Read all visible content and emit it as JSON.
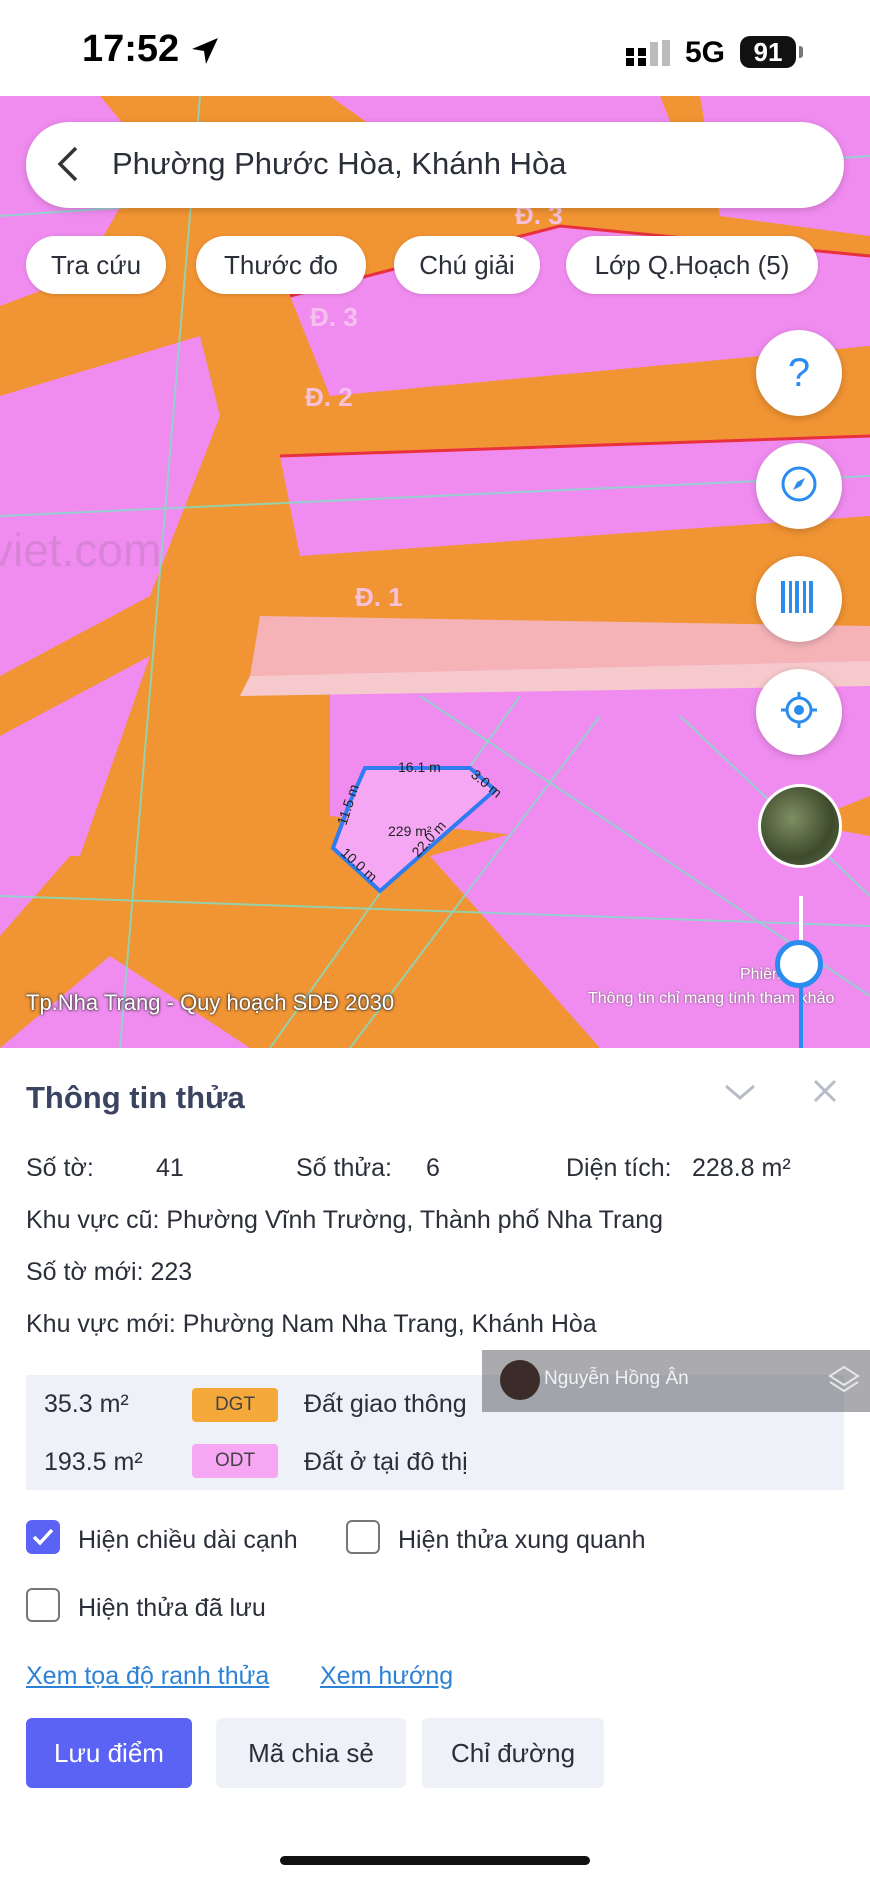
{
  "status_bar": {
    "time": "17:52",
    "network": "5G",
    "battery": "91"
  },
  "search": {
    "query": "Phường Phước Hòa, Khánh Hòa"
  },
  "chips": [
    "Tra cứu",
    "Thước đo",
    "Chú giải",
    "Lớp Q.Hoạch (5)"
  ],
  "map": {
    "road_labels": [
      "Đ. 3",
      "Đ. 3",
      "Đ. 2",
      "Đ. 1"
    ],
    "watermark_text": "viet.com",
    "plot": {
      "area_label": "229 m²",
      "edges": [
        "16.1 m",
        "3.0 m",
        "22.0 m",
        "10.0 m",
        "11.5 m"
      ]
    },
    "layer_label": "Tp.Nha Trang - Quy hoạch SDĐ 2030",
    "version_note": "Phiên 4.1",
    "disclaimer": "Thông tin chỉ mang tính tham khảo",
    "fabs": [
      "help-icon",
      "compass-icon",
      "barcode-icon",
      "locate-icon",
      "satellite-layer"
    ]
  },
  "panel": {
    "title": "Thông tin thửa",
    "so_to_label": "Số tờ:",
    "so_to_value": "41",
    "so_thua_label": "Số thửa:",
    "so_thua_value": "6",
    "dien_tich_label": "Diện tích:",
    "dien_tich_value": "228.8 m²",
    "khu_vuc_cu": "Khu vực cũ: Phường Vĩnh Trường, Thành phố Nha Trang",
    "so_to_moi": "Số tờ mới: 223",
    "khu_vuc_moi": "Khu vực mới: Phường Nam Nha Trang, Khánh Hòa",
    "land_uses": [
      {
        "area": "35.3 m²",
        "code": "DGT",
        "name": "Đất giao thông",
        "color": "#f5a93a"
      },
      {
        "area": "193.5 m²",
        "code": "ODT",
        "name": "Đất ở tại đô thị",
        "color": "#f7a6f3"
      }
    ],
    "watermark_user": "Nguyễn Hồng Ân",
    "checkboxes": [
      {
        "label": "Hiện chiều dài cạnh",
        "checked": true
      },
      {
        "label": "Hiện thửa xung quanh",
        "checked": false
      },
      {
        "label": "Hiện thửa đã lưu",
        "checked": false
      }
    ],
    "links": [
      "Xem tọa độ ranh thửa",
      "Xem hướng"
    ],
    "buttons": [
      "Lưu điểm",
      "Mã chia sẻ",
      "Chỉ đường"
    ]
  },
  "colors": {
    "accent": "#5b63f5",
    "link": "#2e82d6",
    "map_orange": "#f19433",
    "map_pink": "#f08cf0"
  }
}
